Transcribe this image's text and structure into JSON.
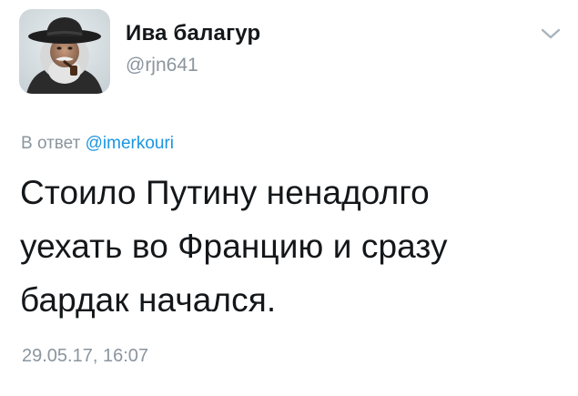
{
  "author": {
    "display_name": "Ива балагур",
    "handle": "@rjn641",
    "avatar_icon": "person-with-hat-and-pipe-avatar"
  },
  "menu": {
    "icon": "chevron-down-icon"
  },
  "reply": {
    "prefix": "В ответ",
    "mention": "@imerkouri"
  },
  "tweet": {
    "lines": [
      "Стоило Путину ненадолго",
      "уехать во Францию и сразу",
      "бардак начался."
    ],
    "timestamp": "29.05.17, 16:07"
  },
  "colors": {
    "text": "#14171a",
    "secondary": "#8b959e",
    "link": "#1b95e0"
  }
}
